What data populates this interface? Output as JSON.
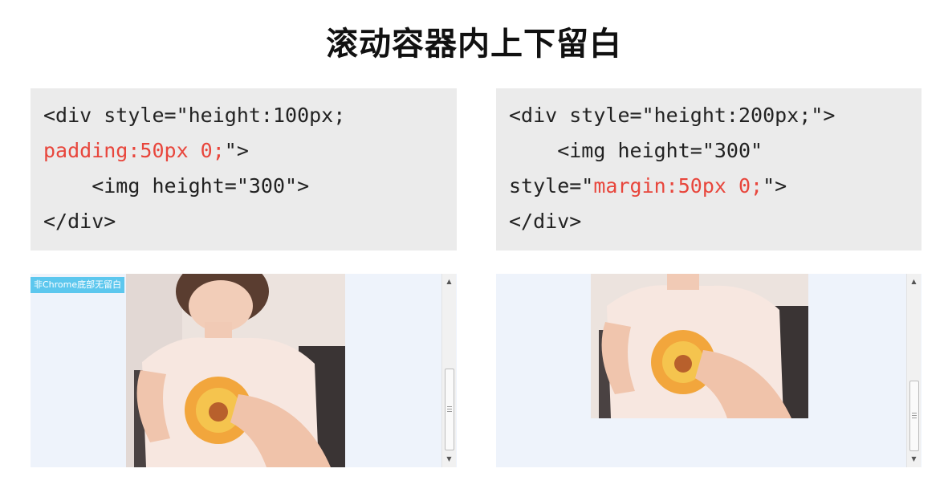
{
  "slide": {
    "title": "滚动容器内上下留白"
  },
  "left_example": {
    "code": {
      "line1": "<div style=\"height:100px;",
      "line2_red": "padding:50px 0;",
      "line2_rest": "\">",
      "line3": "    <img height=\"300\">",
      "line4": "</div>"
    },
    "demo": {
      "badge": "非Chrome底部无留白"
    }
  },
  "right_example": {
    "code": {
      "line1": "<div style=\"height:200px;\">",
      "line2": "    <img height=\"300\"",
      "line3_start": "style=\"",
      "line3_red": "margin:50px 0;",
      "line3_end": "\">",
      "line4": "</div>"
    }
  },
  "scrollbar": {
    "up_arrow": "▲",
    "down_arrow": "▼"
  },
  "colors": {
    "code_background": "#ebebeb",
    "highlight_red": "#e8463c",
    "demo_background": "#eef3fb",
    "badge_background": "#5cc7ee"
  }
}
